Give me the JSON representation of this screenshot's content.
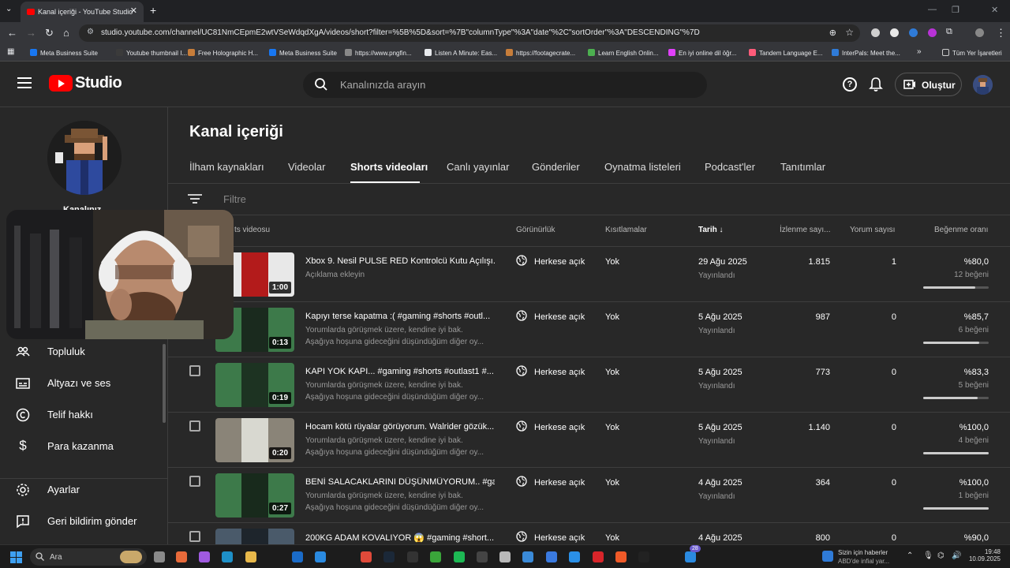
{
  "browser": {
    "tab_title": "Kanal içeriği - YouTube Studio",
    "url": "studio.youtube.com/channel/UC81NmCEpmE2wtVSeWdqdXgA/videos/short?filter=%5B%5D&sort=%7B\"columnType\"%3A\"date\"%2C\"sortOrder\"%3A\"DESCENDING\"%7D",
    "bookmarks": [
      {
        "label": "Meta Business Suite",
        "color": "#1877f2"
      },
      {
        "label": "Youtube thumbnail I...",
        "color": "#3b3b3b"
      },
      {
        "label": "Free Holographic H...",
        "color": "#c77d3a"
      },
      {
        "label": "Meta Business Suite",
        "color": "#1877f2"
      },
      {
        "label": "https://www.pngfin...",
        "color": "#888888"
      },
      {
        "label": "Listen A Minute: Eas...",
        "color": "#e8eaed"
      },
      {
        "label": "https://footagecrate...",
        "color": "#c77d3a"
      },
      {
        "label": "Learn English Onlin...",
        "color": "#4caf50"
      },
      {
        "label": "En iyi online dil öğr...",
        "color": "#e040fb"
      },
      {
        "label": "Tandem Language E...",
        "color": "#ff5c7a"
      },
      {
        "label": "InterPals: Meet the...",
        "color": "#2f7bd8"
      }
    ],
    "bookmarks_more": "»",
    "all_bookmarks": "Tüm Yer İşaretleri"
  },
  "header": {
    "logo_text": "Studio",
    "search_placeholder": "Kanalınızda arayın",
    "create_label": "Oluştur"
  },
  "sidebar": {
    "channel_name": "Kanalınız",
    "items": [
      {
        "label": "Topluluk",
        "icon": "community-icon"
      },
      {
        "label": "Altyazı ve ses",
        "icon": "subtitles-icon"
      },
      {
        "label": "Telif hakkı",
        "icon": "copyright-icon"
      },
      {
        "label": "Para kazanma",
        "icon": "dollar-icon"
      },
      {
        "label": "Ayarlar",
        "icon": "gear-icon"
      },
      {
        "label": "Geri bildirim gönder",
        "icon": "feedback-icon"
      }
    ]
  },
  "main": {
    "title": "Kanal içeriği",
    "tabs": [
      {
        "label": "İlham kaynakları"
      },
      {
        "label": "Videolar"
      },
      {
        "label": "Shorts videoları",
        "active": true
      },
      {
        "label": "Canlı yayınlar"
      },
      {
        "label": "Gönderiler"
      },
      {
        "label": "Oynatma listeleri"
      },
      {
        "label": "Podcast'ler"
      },
      {
        "label": "Tanıtımlar"
      }
    ],
    "filter_placeholder": "Filtre",
    "columns": {
      "video": "ts videosu",
      "visibility": "Görünürlük",
      "restrictions": "Kısıtlamalar",
      "date": "Tarih",
      "views": "İzlenme sayı...",
      "comments": "Yorum sayısı",
      "likes": "Beğenme oranı"
    },
    "rows": [
      {
        "title": "Xbox 9. Nesil PULSE RED Kontrolcü Kutu Açılışı...",
        "d1": "Açıklama ekleyin",
        "d2": "",
        "duration": "1:00",
        "visibility": "Herkese açık",
        "restrictions": "Yok",
        "date": "29 Ağu 2025",
        "status": "Yayınlandı",
        "views": "1.815",
        "comments": "1",
        "ratio": "%80,0",
        "likes": "12 beğeni",
        "ratio_value": 0.8,
        "thumb_bg": "#e8e8e8",
        "thumb_fg": "#b31b1b"
      },
      {
        "title": "Kapıyı terse kapatma :( #gaming #shorts #outl...",
        "d1": "Yorumlarda görüşmek üzere, kendine iyi bak.",
        "d2": "Aşağıya hoşuna gideceğini düşündüğüm diğer oy...",
        "duration": "0:13",
        "visibility": "Herkese açık",
        "restrictions": "Yok",
        "date": "5 Ağu 2025",
        "status": "Yayınlandı",
        "views": "987",
        "comments": "0",
        "ratio": "%85,7",
        "likes": "6 beğeni",
        "ratio_value": 0.857,
        "thumb_bg": "#3d7a4a",
        "thumb_fg": "#1a2a1e"
      },
      {
        "title": "KAPI YOK KAPI... #gaming #shorts #outlast1 #...",
        "d1": "Yorumlarda görüşmek üzere, kendine iyi bak.",
        "d2": "Aşağıya hoşuna gideceğini düşündüğüm diğer oy...",
        "duration": "0:19",
        "visibility": "Herkese açık",
        "restrictions": "Yok",
        "date": "5 Ağu 2025",
        "status": "Yayınlandı",
        "views": "773",
        "comments": "0",
        "ratio": "%83,3",
        "likes": "5 beğeni",
        "ratio_value": 0.833,
        "thumb_bg": "#3d7a4a",
        "thumb_fg": "#1d3322"
      },
      {
        "title": "Hocam kötü rüyalar görüyorum. Walrider gözük...",
        "d1": "Yorumlarda görüşmek üzere, kendine iyi bak.",
        "d2": "Aşağıya hoşuna gideceğini düşündüğüm diğer oy...",
        "duration": "0:20",
        "visibility": "Herkese açık",
        "restrictions": "Yok",
        "date": "5 Ağu 2025",
        "status": "Yayınlandı",
        "views": "1.140",
        "comments": "0",
        "ratio": "%100,0",
        "likes": "4 beğeni",
        "ratio_value": 1.0,
        "thumb_bg": "#8a8478",
        "thumb_fg": "#d8d8d0"
      },
      {
        "title": "BENİ SALACAKLARINI DÜŞÜNMÜYORUM.. #ga...",
        "d1": "Yorumlarda görüşmek üzere, kendine iyi bak.",
        "d2": "Aşağıya hoşuna gideceğini düşündüğüm diğer oy...",
        "duration": "0:27",
        "visibility": "Herkese açık",
        "restrictions": "Yok",
        "date": "4 Ağu 2025",
        "status": "Yayınlandı",
        "views": "364",
        "comments": "0",
        "ratio": "%100,0",
        "likes": "1 beğeni",
        "ratio_value": 1.0,
        "thumb_bg": "#3d7a4a",
        "thumb_fg": "#182a1c"
      },
      {
        "title": "200KG ADAM KOVALIYOR 😱 #gaming #short...",
        "d1": "",
        "d2": "",
        "duration": "",
        "visibility": "Herkese açık",
        "restrictions": "Yok",
        "date": "4 Ağu 2025",
        "status": "",
        "views": "800",
        "comments": "0",
        "ratio": "%90,0",
        "likes": "",
        "ratio_value": 0.9,
        "thumb_bg": "#4a5a6a",
        "thumb_fg": "#1e252c"
      }
    ]
  },
  "taskbar": {
    "search_label": "Ara",
    "news_title": "Sizin için haberler",
    "news_sub": "ABD'de infial yar...",
    "time": "19:48",
    "date": "10.09.2025",
    "badge": "28"
  }
}
